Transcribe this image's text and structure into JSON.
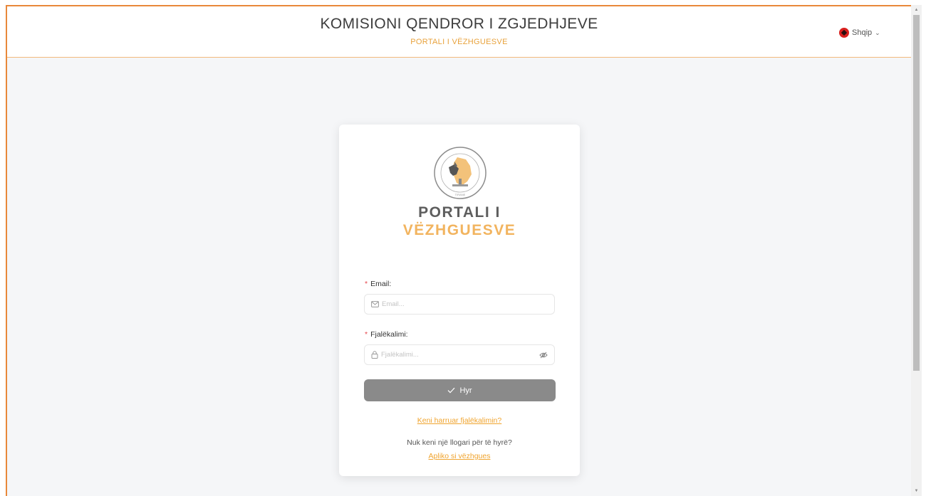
{
  "header": {
    "title": "KOMISIONI QENDROR I ZGJEDHJEVE",
    "subtitle": "PORTALI I VËZHGUESVE",
    "language": "Shqip"
  },
  "card": {
    "portal_line1": "PORTALI I",
    "portal_line2": "VËZHGUESVE",
    "email": {
      "label": "Email:",
      "placeholder": "Email...",
      "value": ""
    },
    "password": {
      "label": "Fjalëkalimi:",
      "placeholder": "Fjalëkalimi...",
      "value": ""
    },
    "login_button": "Hyr",
    "forgot_link": "Keni harruar fjalëkalimin?",
    "no_account_text": "Nuk keni një llogari për të hyrë?",
    "apply_link": "Apliko si vëzhgues"
  },
  "icons": {
    "flag": "albania-flag-icon",
    "lang_chevron": "chevron-down-icon",
    "email": "mail-icon",
    "password": "lock-icon",
    "toggle_visibility": "eye-off-icon",
    "login": "check-icon"
  },
  "colors": {
    "accent": "#e8a23c",
    "frame_border": "#e8883a",
    "button": "#8a8a8a",
    "required": "#e5484d"
  }
}
